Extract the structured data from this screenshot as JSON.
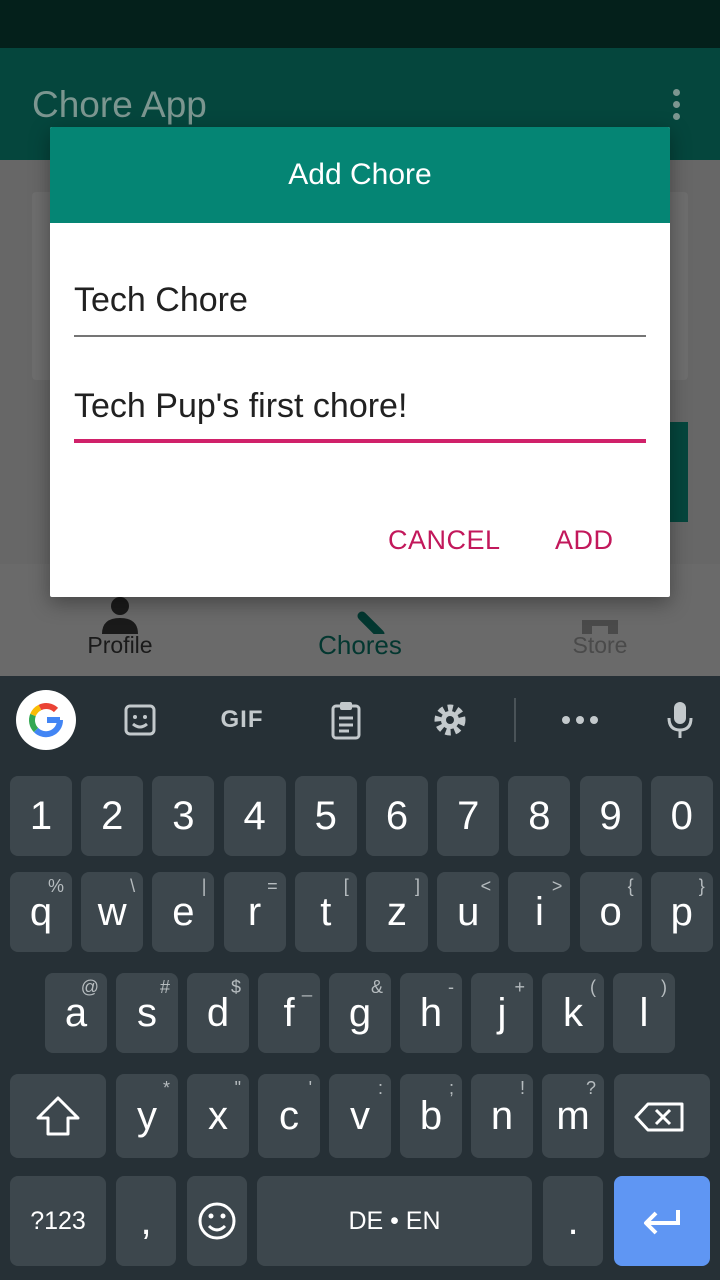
{
  "app": {
    "title": "Chore App",
    "menu_icon": "more-vert-icon"
  },
  "bottom_nav": {
    "items": [
      {
        "label": "Profile",
        "icon": "person-icon"
      },
      {
        "label": "Chores",
        "icon": "search-icon"
      },
      {
        "label": "Store",
        "icon": "store-icon"
      }
    ],
    "selected": "Chores"
  },
  "dialog": {
    "title": "Add Chore",
    "name_value": "Tech Chore",
    "description_value": "Tech Pup's first chore!",
    "cancel_label": "CANCEL",
    "add_label": "ADD",
    "header_color": "#058574",
    "accent_color": "#d0216a"
  },
  "keyboard": {
    "suggestion_bar": {
      "google": "google-g-icon",
      "sticker": "sticker-icon",
      "gif_label": "GIF",
      "clipboard": "clipboard-icon",
      "settings": "gear-icon",
      "more": "more-horiz-icon",
      "mic": "mic-icon"
    },
    "row1": [
      "1",
      "2",
      "3",
      "4",
      "5",
      "6",
      "7",
      "8",
      "9",
      "0"
    ],
    "row2": [
      {
        "k": "q",
        "h": "%"
      },
      {
        "k": "w",
        "h": "\\"
      },
      {
        "k": "e",
        "h": "|"
      },
      {
        "k": "r",
        "h": "="
      },
      {
        "k": "t",
        "h": "["
      },
      {
        "k": "z",
        "h": "]"
      },
      {
        "k": "u",
        "h": "<"
      },
      {
        "k": "i",
        "h": ">"
      },
      {
        "k": "o",
        "h": "{"
      },
      {
        "k": "p",
        "h": "}"
      }
    ],
    "row3": [
      {
        "k": "a",
        "h": "@"
      },
      {
        "k": "s",
        "h": "#"
      },
      {
        "k": "d",
        "h": "$"
      },
      {
        "k": "f",
        "h": "_"
      },
      {
        "k": "g",
        "h": "&"
      },
      {
        "k": "h",
        "h": "-"
      },
      {
        "k": "j",
        "h": "+"
      },
      {
        "k": "k",
        "h": "("
      },
      {
        "k": "l",
        "h": ")"
      }
    ],
    "row4": [
      {
        "k": "y",
        "h": "*"
      },
      {
        "k": "x",
        "h": "\""
      },
      {
        "k": "c",
        "h": "'"
      },
      {
        "k": "v",
        "h": ":"
      },
      {
        "k": "b",
        "h": ";"
      },
      {
        "k": "n",
        "h": "!"
      },
      {
        "k": "m",
        "h": "?"
      }
    ],
    "symbols_label": "?123",
    "comma": ",",
    "period": ".",
    "space_label": "DE • EN",
    "accent_color": "#5f96f3"
  }
}
